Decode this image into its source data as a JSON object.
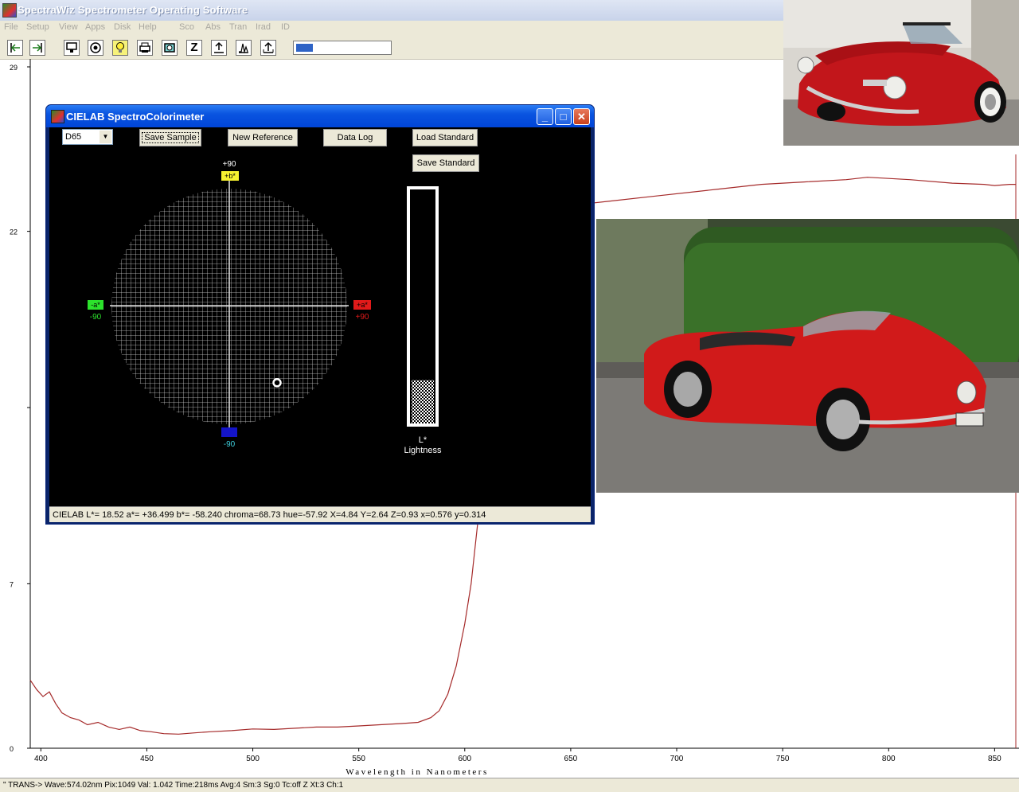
{
  "app": {
    "title": "SpectraWiz  Spectrometer Operating Software",
    "menu": [
      "File",
      "Setup",
      "View",
      "Apps",
      "Disk",
      "Help",
      "Sco",
      "Abs",
      "Tran",
      "Irad",
      "ID"
    ]
  },
  "toolbar": {
    "icons": [
      "step-left-icon",
      "step-right-icon",
      "monitor-icon",
      "record-icon",
      "lamp-icon",
      "printer-icon",
      "camera-icon",
      "z-zero-icon",
      "upload-icon",
      "peaks-icon",
      "export-icon"
    ],
    "z_label": "Z",
    "progress": 0.18
  },
  "chart_data": {
    "type": "line",
    "xlabel": "Wavelength in Nanometers",
    "ylabel": "",
    "xlim": [
      395,
      860
    ],
    "ylim": [
      0,
      29
    ],
    "x_ticks": [
      400,
      450,
      500,
      550,
      600,
      650,
      700,
      750,
      800,
      850
    ],
    "y_ticks": [
      {
        "label": "29",
        "value": 29
      },
      {
        "label": "22",
        "value": 22
      },
      {
        "label": "",
        "value": 14.5
      },
      {
        "label": "7",
        "value": 7
      },
      {
        "label": "0",
        "value": 0
      }
    ],
    "series": [
      {
        "color": "#a52a2a",
        "points": [
          [
            395,
            2.9
          ],
          [
            398,
            2.5
          ],
          [
            401,
            2.2
          ],
          [
            404,
            2.4
          ],
          [
            407,
            1.9
          ],
          [
            410,
            1.5
          ],
          [
            414,
            1.3
          ],
          [
            418,
            1.2
          ],
          [
            422,
            1.0
          ],
          [
            427,
            1.1
          ],
          [
            432,
            0.9
          ],
          [
            437,
            0.8
          ],
          [
            442,
            0.9
          ],
          [
            447,
            0.75
          ],
          [
            452,
            0.7
          ],
          [
            458,
            0.62
          ],
          [
            465,
            0.6
          ],
          [
            472,
            0.65
          ],
          [
            480,
            0.7
          ],
          [
            490,
            0.75
          ],
          [
            500,
            0.82
          ],
          [
            510,
            0.8
          ],
          [
            520,
            0.85
          ],
          [
            530,
            0.9
          ],
          [
            540,
            0.9
          ],
          [
            550,
            0.95
          ],
          [
            560,
            1.0
          ],
          [
            570,
            1.05
          ],
          [
            578,
            1.1
          ],
          [
            584,
            1.3
          ],
          [
            588,
            1.6
          ],
          [
            592,
            2.3
          ],
          [
            596,
            3.5
          ],
          [
            600,
            5.3
          ],
          [
            603,
            7.0
          ],
          [
            606,
            9.5
          ],
          [
            609,
            12.0
          ],
          [
            612,
            15.0
          ],
          [
            615,
            18.0
          ],
          [
            618,
            20.0
          ],
          [
            622,
            21.5
          ],
          [
            628,
            22.4
          ],
          [
            640,
            22.9
          ],
          [
            660,
            23.2
          ],
          [
            690,
            23.5
          ],
          [
            720,
            23.8
          ],
          [
            740,
            24.0
          ],
          [
            760,
            24.1
          ],
          [
            780,
            24.2
          ],
          [
            790,
            24.3
          ],
          [
            810,
            24.2
          ],
          [
            830,
            24.05
          ],
          [
            845,
            24.0
          ],
          [
            850,
            23.95
          ],
          [
            857,
            24.0
          ],
          [
            860,
            24.0
          ]
        ]
      }
    ]
  },
  "status": "\" TRANS->   Wave:574.02nm  Pix:1049  Val:  1.042  Time:218ms  Avg:4  Sm:3  Sg:0  Tc:off  Z  Xt:3  Ch:1",
  "cielab": {
    "title": "CIELAB SpectroColorimeter",
    "illuminant": "D65",
    "buttons": {
      "save_sample": "Save Sample",
      "new_reference": "New Reference",
      "data_log": "Data Log",
      "load_standard": "Load Standard",
      "save_standard": "Save Standard"
    },
    "axis": {
      "b_plus_value": "+90",
      "b_plus_tag": "+b*",
      "b_minus_tag": "-b*",
      "b_minus_value": "-90",
      "a_minus_tag": "-a*",
      "a_minus_value": "-90",
      "a_plus_tag": "+a*",
      "a_plus_value": "+90"
    },
    "lightness_label": "L*",
    "lightness_caption": "Lightness",
    "L": 18.52,
    "a": 36.499,
    "b": -58.24,
    "status": "CIELAB L*= 18.52  a*= +36.499  b*= -58.240  chroma=68.73  hue=-57.92  X=4.84  Y=2.64  Z=0.93  x=0.576  y=0.314"
  },
  "photos": [
    "red-convertible-photo",
    "red-roadster-photo"
  ],
  "colors": {
    "plot_line": "#a52a2a",
    "car_red": "#c8121a",
    "dialog_title": "#0a54e0"
  }
}
